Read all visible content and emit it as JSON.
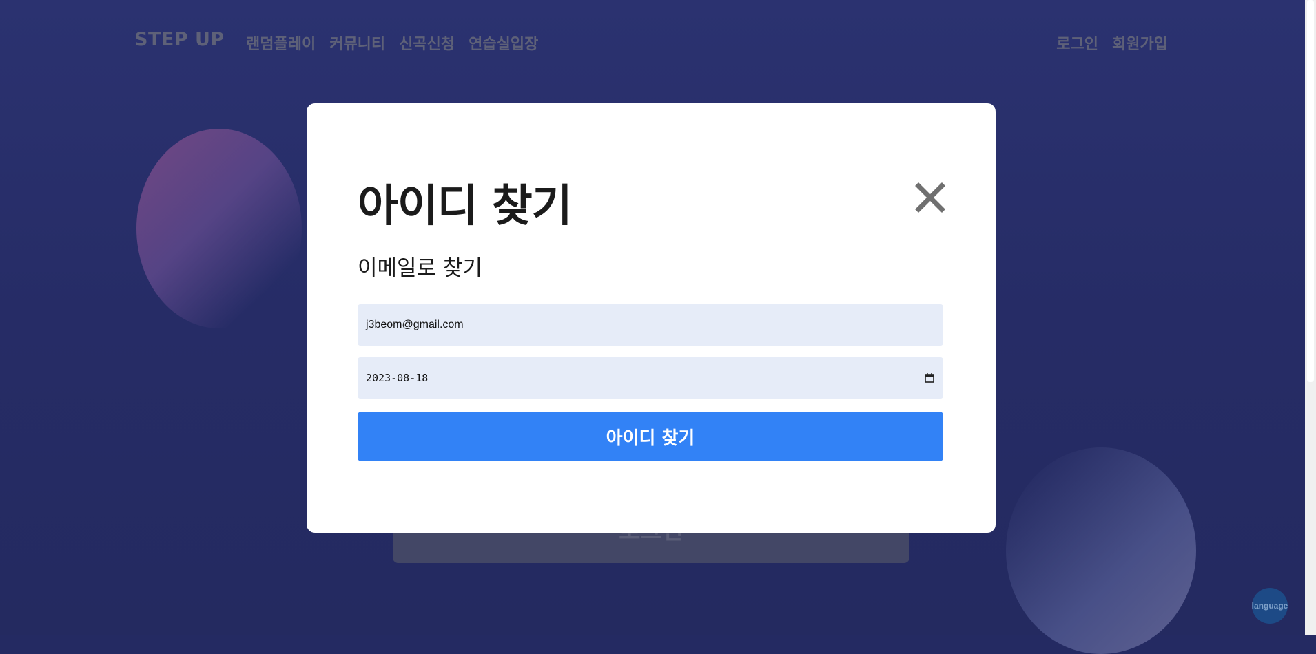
{
  "nav": {
    "logo": "STEP UP",
    "menu": [
      "랜덤플레이",
      "커뮤니티",
      "신곡신청",
      "연습실입장"
    ],
    "auth": [
      "로그인",
      "회원가입"
    ]
  },
  "background": {
    "card_label": "로그인"
  },
  "modal": {
    "title": "아이디 찾기",
    "subtitle": "이메일로 찾기",
    "email_value": "j3beom@gmail.com",
    "date_value": "2023-08-18",
    "submit_label": "아이디 찾기"
  },
  "language_button": "language",
  "colors": {
    "background": "#242a62",
    "accent": "#3282f6",
    "input_bg": "#e6ecf8"
  },
  "icons": [
    "close-icon",
    "calendar-icon"
  ]
}
